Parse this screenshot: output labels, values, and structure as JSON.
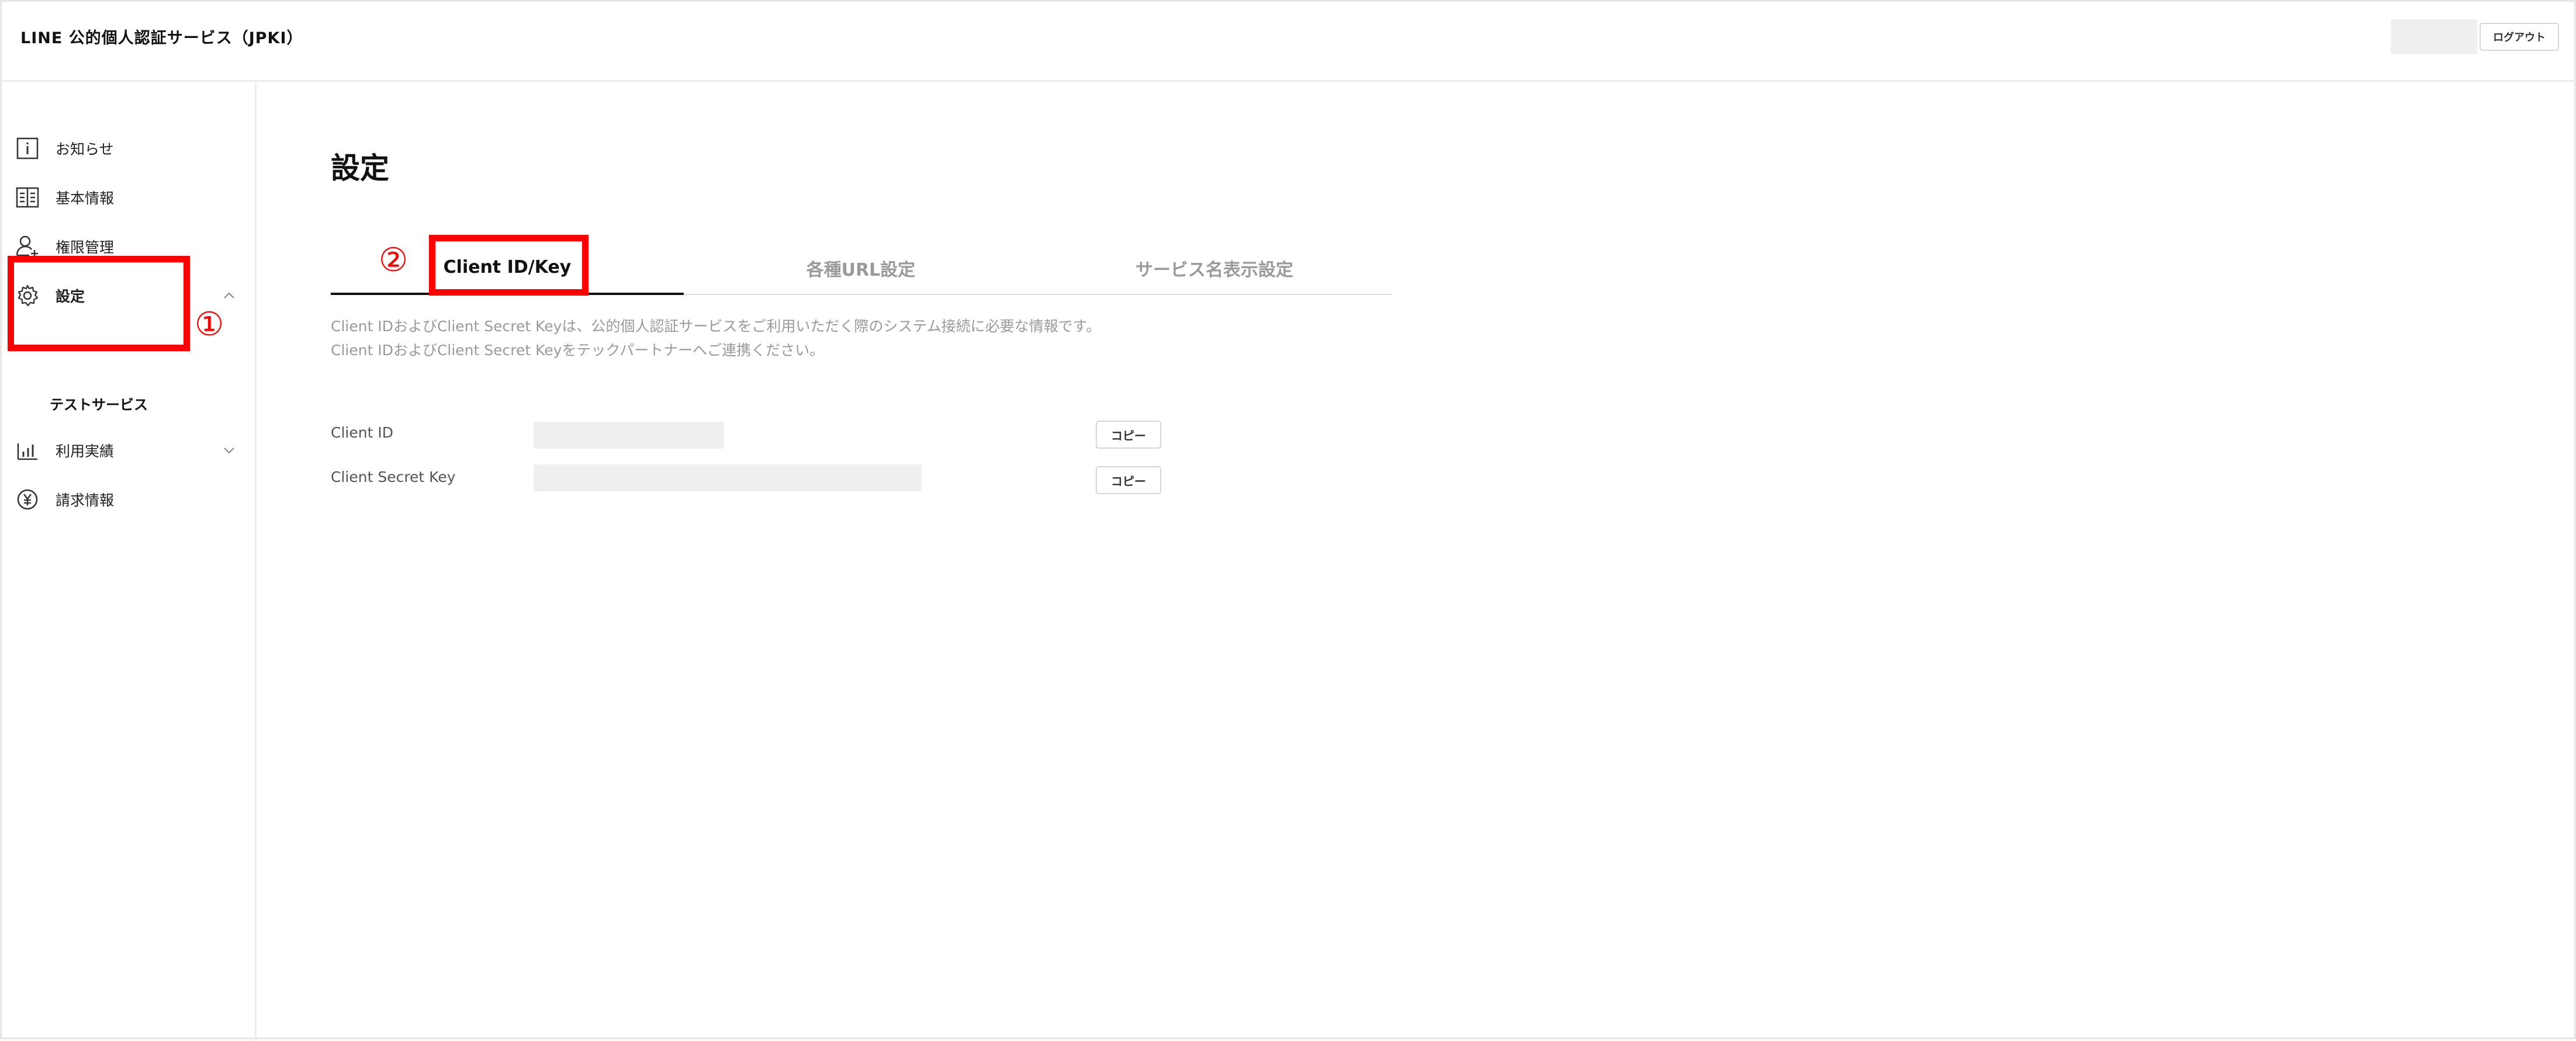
{
  "header": {
    "app_title": "LINE 公的個人認証サービス（JPKI）",
    "logout_label": "ログアウト"
  },
  "sidebar": {
    "items": [
      {
        "label": "お知らせ",
        "icon": "info-icon"
      },
      {
        "label": "基本情報",
        "icon": "book-icon"
      },
      {
        "label": "権限管理",
        "icon": "user-add-icon"
      },
      {
        "label": "設定",
        "icon": "gear-icon",
        "expanded": true
      },
      {
        "label": "利用実績",
        "icon": "bar-chart-icon",
        "expanded": false
      },
      {
        "label": "請求情報",
        "icon": "yen-coin-icon"
      }
    ],
    "sub_items": [
      {
        "label": "テストサービス"
      }
    ]
  },
  "annotations": {
    "marker_1": "①",
    "marker_2": "②",
    "color": "#ff0000"
  },
  "main": {
    "page_title": "設定",
    "tabs": [
      {
        "label": "Client ID/Key",
        "active": true
      },
      {
        "label": "各種URL設定",
        "active": false
      },
      {
        "label": "サービス名表示設定",
        "active": false
      }
    ],
    "description": [
      "Client IDおよびClient Secret Keyは、公的個人認証サービスをご利用いただく際のシステム接続に必要な情報です。",
      "Client IDおよびClient Secret Keyをテックパートナーへご連携ください。"
    ],
    "fields": [
      {
        "label": "Client ID",
        "value": "",
        "copy_label": "コピー"
      },
      {
        "label": "Client Secret Key",
        "value": "",
        "copy_label": "コピー"
      }
    ]
  }
}
